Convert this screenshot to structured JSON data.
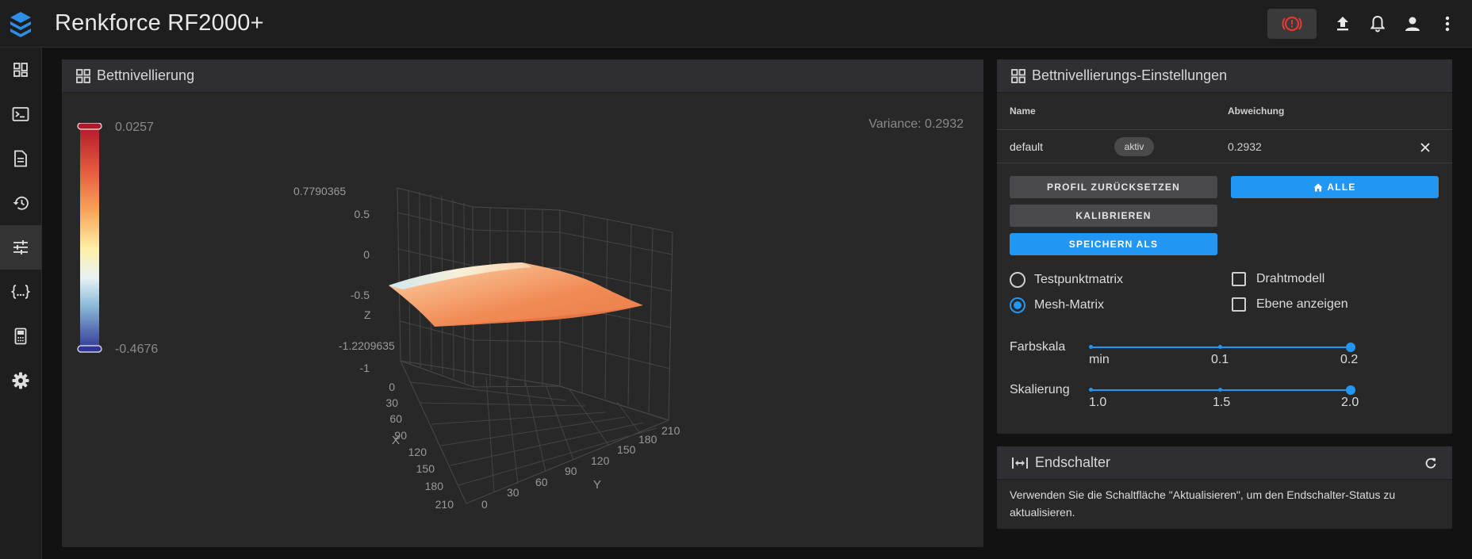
{
  "app": {
    "title": "Renkforce RF2000+"
  },
  "bed_mesh": {
    "title": "Bettnivellierung",
    "variance_text": "Variance: 0.2932",
    "colorbar": {
      "max": "0.0257",
      "min": "-0.4676"
    },
    "plot": {
      "z_axis_label": "Z",
      "x_axis_label": "X",
      "y_axis_label": "Y",
      "z_max": "0.7790365",
      "z_min": "-1.2209635",
      "z_ticks": [
        "0.5",
        "0",
        "-0.5",
        "-1"
      ],
      "x_ticks": [
        "0",
        "30",
        "60",
        "90",
        "120",
        "150",
        "180",
        "210"
      ],
      "y_ticks": [
        "0",
        "30",
        "60",
        "90",
        "120",
        "150",
        "180",
        "210"
      ]
    }
  },
  "settings": {
    "title": "Bettnivellierungs-Einstellungen",
    "table": {
      "headers": {
        "name": "Name",
        "deviation": "Abweichung"
      },
      "row": {
        "name": "default",
        "badge": "aktiv",
        "deviation": "0.2932"
      }
    },
    "buttons": {
      "reset": "Profil zurücksetzen",
      "home_all": "Alle",
      "calibrate": "Kalibrieren",
      "save_as": "Speichern als"
    },
    "options": {
      "probe_matrix": "Testpunktmatrix",
      "mesh_matrix": "Mesh-Matrix",
      "wireframe": "Drahtmodell",
      "show_plane": "Ebene anzeigen",
      "selected_radio": "Mesh-Matrix"
    },
    "sliders": {
      "color_scale": {
        "label": "Farbskala",
        "ticks": [
          "min",
          "0.1",
          "0.2"
        ],
        "value": "0.2"
      },
      "scaling": {
        "label": "Skalierung",
        "ticks": [
          "1.0",
          "1.5",
          "2.0"
        ],
        "value": "2.0"
      }
    }
  },
  "endstops": {
    "title": "Endschalter",
    "message": "Verwenden Sie die Schaltfläche \"Aktualisieren\", um den Endschalter-Status zu aktualisieren."
  },
  "colors": {
    "accent": "#2196f3",
    "emergency": "#e53935",
    "surface_warm": "#f08a55"
  }
}
